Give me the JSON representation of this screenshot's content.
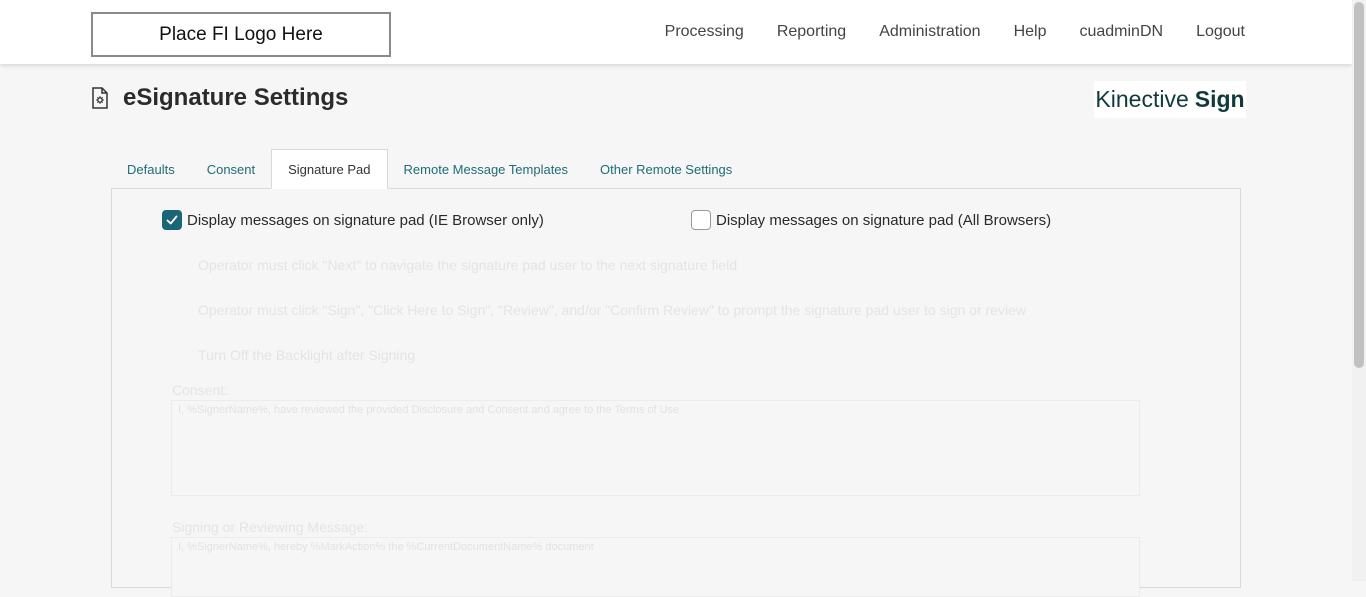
{
  "header": {
    "logo_text": "Place FI Logo Here",
    "nav": [
      "Processing",
      "Reporting",
      "Administration",
      "Help",
      "cuadminDN",
      "Logout"
    ]
  },
  "page": {
    "title": "eSignature Settings",
    "title_icon": "settings-document-icon",
    "brand_light": "Kinective",
    "brand_bold": "Sign"
  },
  "tabs": [
    {
      "label": "Defaults",
      "active": false
    },
    {
      "label": "Consent",
      "active": false
    },
    {
      "label": "Signature Pad",
      "active": true
    },
    {
      "label": "Remote Message Templates",
      "active": false
    },
    {
      "label": "Other Remote Settings",
      "active": false
    }
  ],
  "signature_pad": {
    "ie_only_label": "Display messages on signature pad (IE Browser only)",
    "ie_only_checked": true,
    "all_browsers_label": "Display messages on signature pad (All Browsers)",
    "all_browsers_checked": false,
    "options": [
      "Operator must click \"Next\" to navigate the signature pad user to the next signature field",
      "Operator must click \"Sign\", \"Click Here to Sign\", \"Review\", and/or \"Confirm Review\" to prompt the signature pad user to sign or review",
      "Turn Off the Backlight after Signing"
    ],
    "consent_label": "Consent:",
    "consent_value": "I, %SignerName%, have reviewed the provided Disclosure and Consent and agree to the Terms of Use",
    "signing_label": "Signing or Reviewing Message:",
    "signing_value": "I, %SignerName%, hereby %MarkAction% the %CurrentDocumentName% document"
  },
  "colors": {
    "accent": "#1b6577",
    "tab_link": "#1f6c78",
    "brand": "#0f3a3c"
  }
}
